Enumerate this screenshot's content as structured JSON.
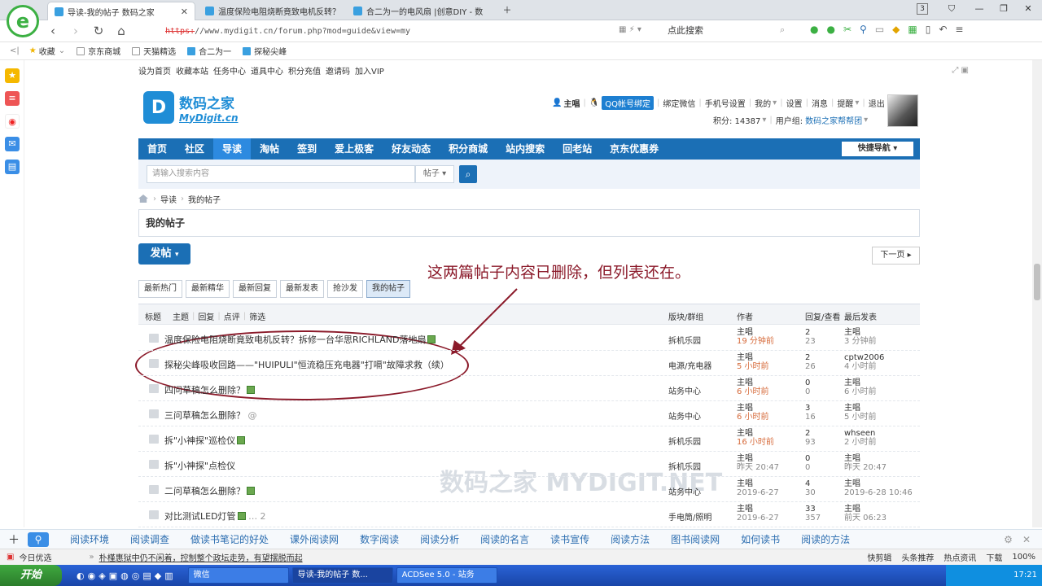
{
  "browser": {
    "tabs": [
      {
        "label": "导读-我的帖子 数码之家",
        "active": true
      },
      {
        "label": "温度保险电阻烧断竟致电机反转？"
      },
      {
        "label": "合二为一的电风扇 |创意DIY - 数"
      }
    ],
    "tab_count": "3",
    "url_scheme": "https:",
    "url_rest": "//www.mydigit.cn/forum.php?mod=guide&view=my",
    "search_placeholder": "点此搜索",
    "bookmarks": [
      "收藏",
      "京东商城",
      "天猫精选",
      "合二为一",
      "探秘尖峰"
    ]
  },
  "site": {
    "toplinks": [
      "设为首页",
      "收藏本站",
      "任务中心",
      "道具中心",
      "积分充值",
      "邀请码",
      "加入VIP"
    ],
    "brand_cn": "数码之家",
    "brand_en": "MyDigit.cn",
    "user": {
      "name": "主唱",
      "qq": "QQ帐号绑定",
      "links": [
        "绑定微信",
        "手机号设置",
        "我的",
        "设置",
        "消息",
        "提醒",
        "退出"
      ],
      "score_label": "积分: 14387",
      "group_label": "用户组:",
      "group_value": "数码之家帮帮团"
    },
    "nav": [
      "首页",
      "社区",
      "导读",
      "淘帖",
      "签到",
      "爱上极客",
      "好友动态",
      "积分商城",
      "站内搜索",
      "回老站",
      "京东优惠券"
    ],
    "nav_active": "导读",
    "quicknav": "快捷导航",
    "search_placeholder": "请输入搜索内容",
    "search_type": "帖子",
    "breadcrumb": [
      "导读",
      "我的帖子"
    ],
    "page_title": "我的帖子",
    "post_button": "发帖",
    "next_button": "下一页",
    "filters": [
      "最新热门",
      "最新精华",
      "最新回复",
      "最新发表",
      "抢沙发",
      "我的帖子"
    ],
    "filter_active": "我的帖子",
    "list_head": {
      "title": "标题",
      "subs": [
        "主题",
        "回复",
        "点评",
        "筛选"
      ],
      "forum": "版块/群组",
      "author": "作者",
      "counts": "回复/查看",
      "last": "最后发表"
    },
    "annotation": "这两篇帖子内容已删除，但列表还在。",
    "watermark": "数码之家 MYDIGIT.NET"
  },
  "posts": [
    {
      "title": "温度保险电阻烧断竟致电机反转？拆修一台华思RICHLAND落地扇",
      "img": true,
      "forum": "拆机乐园",
      "author": "主唱",
      "atime": "19 分钟前",
      "replies": "2",
      "views": "23",
      "last_author": "主唱",
      "last_time": "3 分钟前"
    },
    {
      "title": "探秘尖峰吸收回路——\"HUIPULI\"恒流稳压充电器\"打嗝\"故障求救（续）",
      "img": false,
      "forum": "电源/充电器",
      "author": "主唱",
      "atime": "5 小时前",
      "replies": "2",
      "views": "26",
      "last_author": "cptw2006",
      "last_time": "4 小时前"
    },
    {
      "title": "四问草稿怎么删除？",
      "img": true,
      "forum": "站务中心",
      "author": "主唱",
      "atime": "6 小时前",
      "replies": "0",
      "views": "0",
      "last_author": "主唱",
      "last_time": "6 小时前"
    },
    {
      "title": "三问草稿怎么删除？",
      "img": false,
      "extra": "@",
      "forum": "站务中心",
      "author": "主唱",
      "atime": "6 小时前",
      "replies": "3",
      "views": "16",
      "last_author": "主唱",
      "last_time": "5 小时前"
    },
    {
      "title": "拆\"小神探\"巡检仪",
      "img": true,
      "forum": "拆机乐园",
      "author": "主唱",
      "atime": "16 小时前",
      "replies": "2",
      "views": "93",
      "last_author": "whseen",
      "last_time": "2 小时前"
    },
    {
      "title": "拆\"小神探\"点检仪",
      "img": false,
      "forum": "拆机乐园",
      "author": "主唱",
      "atime": "昨天 20:47",
      "atime_gray": true,
      "replies": "0",
      "views": "0",
      "last_author": "主唱",
      "last_time": "昨天 20:47"
    },
    {
      "title": "二问草稿怎么删除？",
      "img": true,
      "forum": "站务中心",
      "author": "主唱",
      "atime": "2019-6-27",
      "atime_gray": true,
      "replies": "4",
      "views": "30",
      "last_author": "主唱",
      "last_time": "2019-6-28 10:46"
    },
    {
      "title": "对比测试LED灯管",
      "img": true,
      "extra": "… 2",
      "forum": "手电筒/照明",
      "author": "主唱",
      "atime": "2019-6-27",
      "atime_gray": true,
      "replies": "33",
      "views": "357",
      "last_author": "主唱",
      "last_time": "前天 06:23"
    }
  ],
  "adbar": [
    "阅读环境",
    "阅读调查",
    "做读书笔记的好处",
    "课外阅读网",
    "数字阅读",
    "阅读分析",
    "阅读的名言",
    "读书宣传",
    "阅读方法",
    "图书阅读网",
    "如何读书",
    "阅读的方法"
  ],
  "newsbar": {
    "label": "今日优选",
    "headline": "朴槿惠狱中仍不闲着，控制整个政坛走势，有望摆脱而起",
    "right": [
      "快剪辑",
      "头条推荐",
      "热点资讯",
      "下载",
      "100%"
    ]
  },
  "taskbar": {
    "start": "开始",
    "tasks": [
      "微信",
      "导读-我的帖子 数...",
      "ACDSee 5.0 - 站务"
    ],
    "time": "17:21"
  }
}
